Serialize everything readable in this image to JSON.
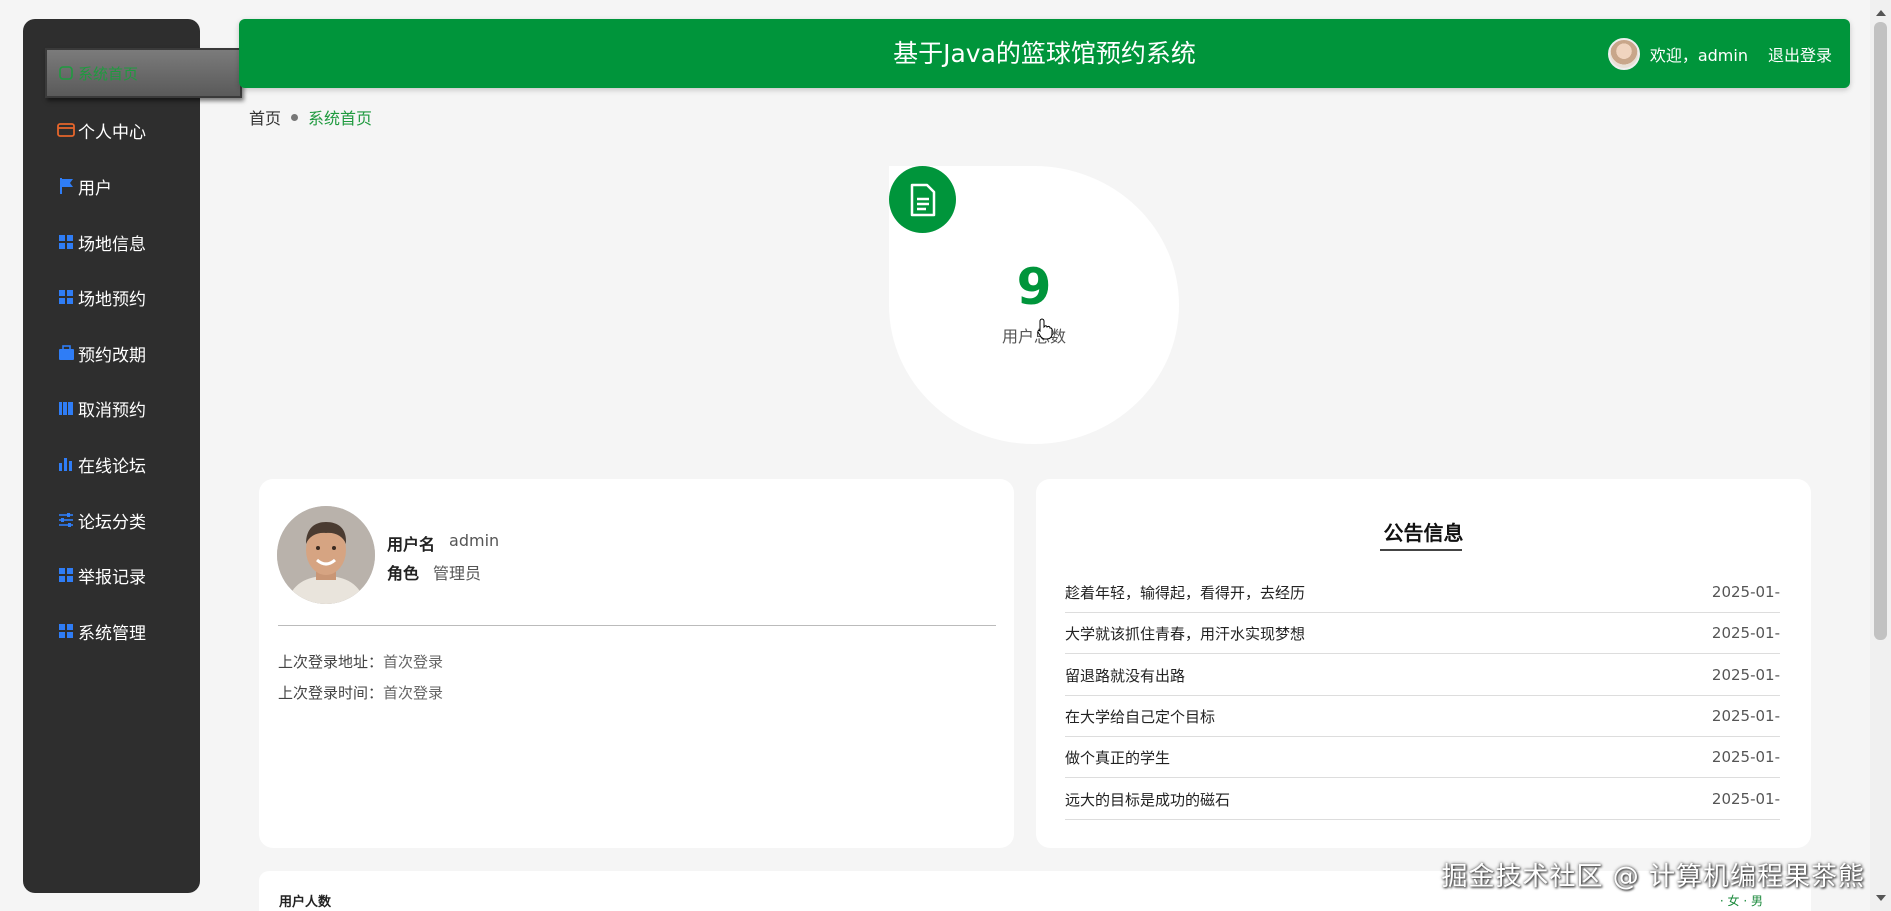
{
  "header": {
    "title": "基于Java的篮球馆预约系统",
    "welcome": "欢迎，admin",
    "logout": "退出登录"
  },
  "sidebar": {
    "items": [
      {
        "label": "系统首页",
        "icon": "home-icon",
        "active": true
      },
      {
        "label": "个人中心",
        "icon": "card-icon",
        "color": "#e5652b"
      },
      {
        "label": "用户",
        "icon": "flag-icon",
        "color": "#2f7df6"
      },
      {
        "label": "场地信息",
        "icon": "grid-icon",
        "color": "#2f7df6"
      },
      {
        "label": "场地预约",
        "icon": "grid-icon",
        "color": "#2f7df6"
      },
      {
        "label": "预约改期",
        "icon": "briefcase-icon",
        "color": "#2f7df6"
      },
      {
        "label": "取消预约",
        "icon": "books-icon",
        "color": "#2f7df6"
      },
      {
        "label": "在线论坛",
        "icon": "bar-chart-icon",
        "color": "#2f7df6"
      },
      {
        "label": "论坛分类",
        "icon": "sliders-icon",
        "color": "#2f7df6"
      },
      {
        "label": "举报记录",
        "icon": "grid-icon",
        "color": "#2f7df6"
      },
      {
        "label": "系统管理",
        "icon": "grid-icon",
        "color": "#2f7df6"
      }
    ]
  },
  "breadcrumb": {
    "home": "首页",
    "current": "系统首页"
  },
  "stat": {
    "value": "9",
    "label": "用户总数",
    "icon": "document-icon"
  },
  "profile": {
    "username_key": "用户名",
    "username": "admin",
    "role_key": "角色",
    "role": "管理员",
    "last_ip_key": "上次登录地址：",
    "last_ip": "首次登录",
    "last_time_key": "上次登录时间：",
    "last_time": "首次登录"
  },
  "notice": {
    "title": "公告信息",
    "items": [
      {
        "title": "趁着年轻，输得起，看得开，去经历",
        "date": "2025-01-"
      },
      {
        "title": "大学就该抓住青春，用汗水实现梦想",
        "date": "2025-01-"
      },
      {
        "title": "留退路就没有出路",
        "date": "2025-01-"
      },
      {
        "title": "在大学给自己定个目标",
        "date": "2025-01-"
      },
      {
        "title": "做个真正的学生",
        "date": "2025-01-"
      },
      {
        "title": "远大的目标是成功的磁石",
        "date": "2025-01-"
      }
    ]
  },
  "bottom": {
    "title": "用户人数",
    "legend": "· 女  · 男"
  },
  "watermark": "掘金技术社区 @ 计算机编程果茶熊",
  "colors": {
    "brand": "#00953b",
    "sidebar_bg": "#2e2e2e",
    "icon_blue": "#2f7df6",
    "icon_orange": "#e5652b"
  }
}
